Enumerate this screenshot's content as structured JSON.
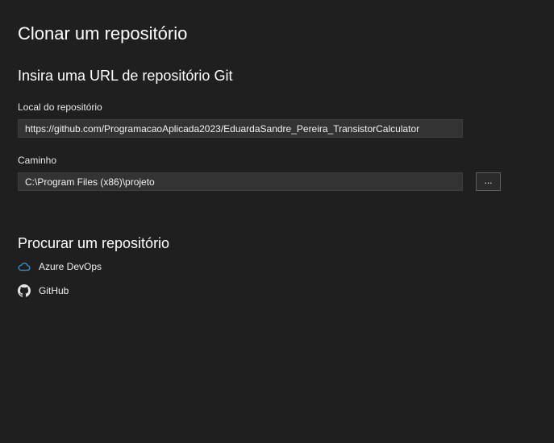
{
  "header": {
    "title": "Clonar um repositório",
    "subtitle": "Insira uma URL de repositório Git"
  },
  "repository_location": {
    "label": "Local do repositório",
    "value": "https://github.com/ProgramacaoAplicada2023/EduardaSandre_Pereira_TransistorCalculator"
  },
  "path": {
    "label": "Caminho",
    "value": "C:\\Program Files (x86)\\projeto",
    "browse_label": "..."
  },
  "browse": {
    "title": "Procurar um repositório",
    "providers": [
      {
        "label": "Azure DevOps",
        "icon": "cloud-icon"
      },
      {
        "label": "GitHub",
        "icon": "github-icon"
      }
    ]
  },
  "colors": {
    "background": "#1f1f1f",
    "input_background": "#333333",
    "azure_icon": "#3794d6"
  }
}
